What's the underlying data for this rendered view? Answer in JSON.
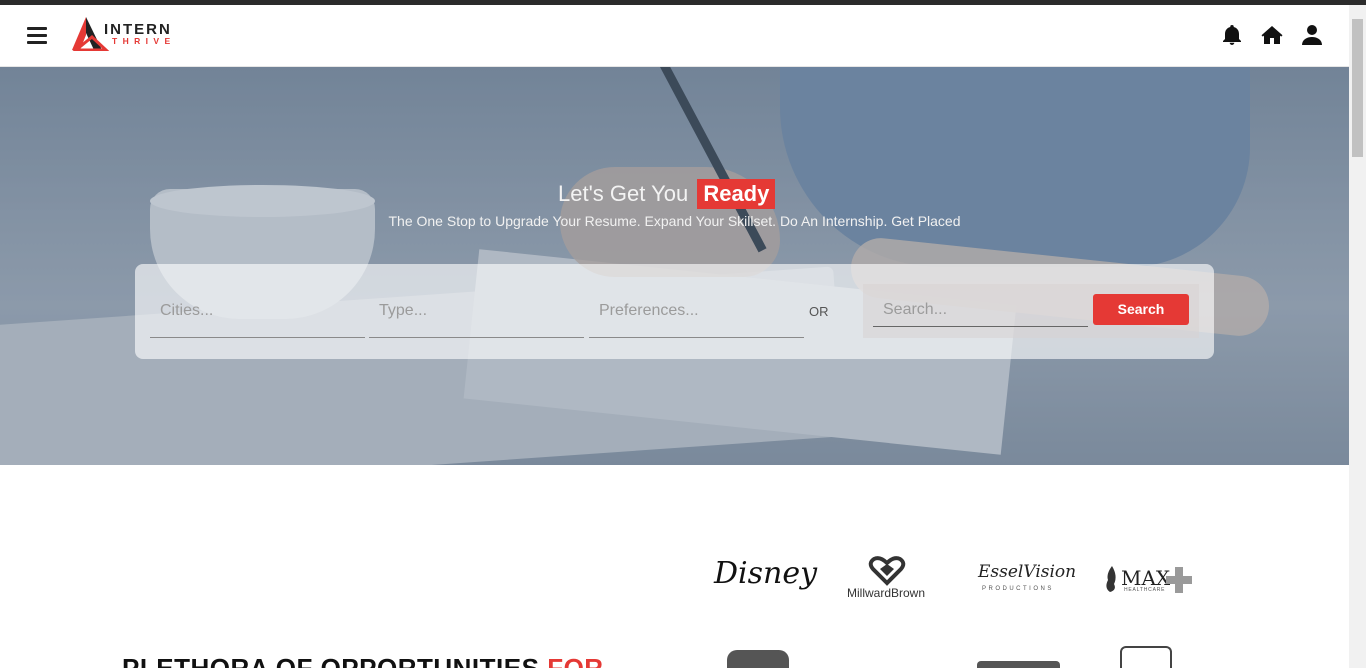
{
  "header": {
    "logo": {
      "word_top": "INTERN",
      "word_bottom": "THRIVE"
    },
    "icons": [
      "bell-icon",
      "home-icon",
      "user-icon"
    ]
  },
  "hero": {
    "title_prefix": "Let's Get You",
    "title_highlight": "Ready",
    "subtitle": "The One Stop to Upgrade Your Resume. Expand Your Skillset. Do An Internship. Get Placed"
  },
  "search": {
    "cities_placeholder": "Cities...",
    "type_placeholder": "Type...",
    "preferences_placeholder": "Preferences...",
    "or_label": "OR",
    "search_placeholder": "Search...",
    "search_button": "Search"
  },
  "brands": {
    "disney": "Disney",
    "millward_top": "MillwardBrown",
    "essel": "EsselVision",
    "essel_sub": "PRODUCTIONS",
    "max": "MAX",
    "max_sub": "HEALTHCARE"
  },
  "section": {
    "heading_prefix": "PLETHORA OF OPPORTUNITIES",
    "heading_accent": "FOR"
  },
  "colors": {
    "accent": "#e53935",
    "text_dark": "#222222"
  }
}
